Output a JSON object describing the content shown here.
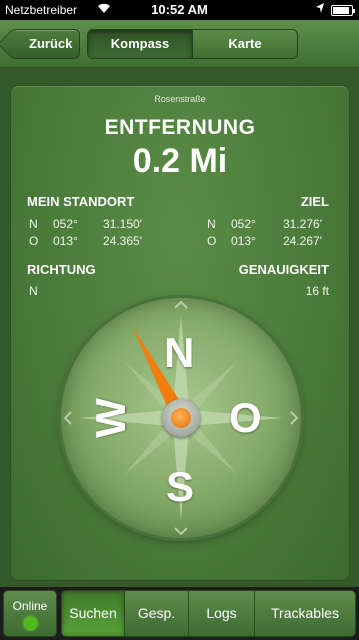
{
  "status_bar": {
    "carrier": "Netzbetreiber",
    "time": "10:52 AM",
    "battery_level": 0.9
  },
  "nav": {
    "back_label": "Zurück",
    "segments": [
      "Kompass",
      "Karte"
    ],
    "active_segment": "Kompass"
  },
  "target": {
    "street": "Rosenstraße",
    "distance_label": "ENTFERNUNG",
    "distance_value": "0.2 Mi"
  },
  "my_location": {
    "title": "MEIN STANDORT",
    "lat_dir": "N",
    "lat_deg": "052°",
    "lat_min": "31.150'",
    "lon_dir": "O",
    "lon_deg": "013°",
    "lon_min": "24.365'"
  },
  "destination": {
    "title": "ZIEL",
    "lat_dir": "N",
    "lat_deg": "052°",
    "lat_min": "31.276'",
    "lon_dir": "O",
    "lon_deg": "013°",
    "lon_min": "24.267'"
  },
  "direction": {
    "title": "RICHTUNG",
    "value": "N"
  },
  "accuracy": {
    "title": "GENAUIGKEIT",
    "value": "16 ft"
  },
  "compass": {
    "N": "N",
    "S": "S",
    "W": "W",
    "O": "O",
    "needle_heading_deg": -28,
    "needle_color": "#f07d0e"
  },
  "tab_bar": {
    "online_label": "Online",
    "online_status_color": "#4fba19",
    "tabs": [
      "Suchen",
      "Gesp.",
      "Logs",
      "Trackables"
    ],
    "active_tab": "Suchen"
  }
}
